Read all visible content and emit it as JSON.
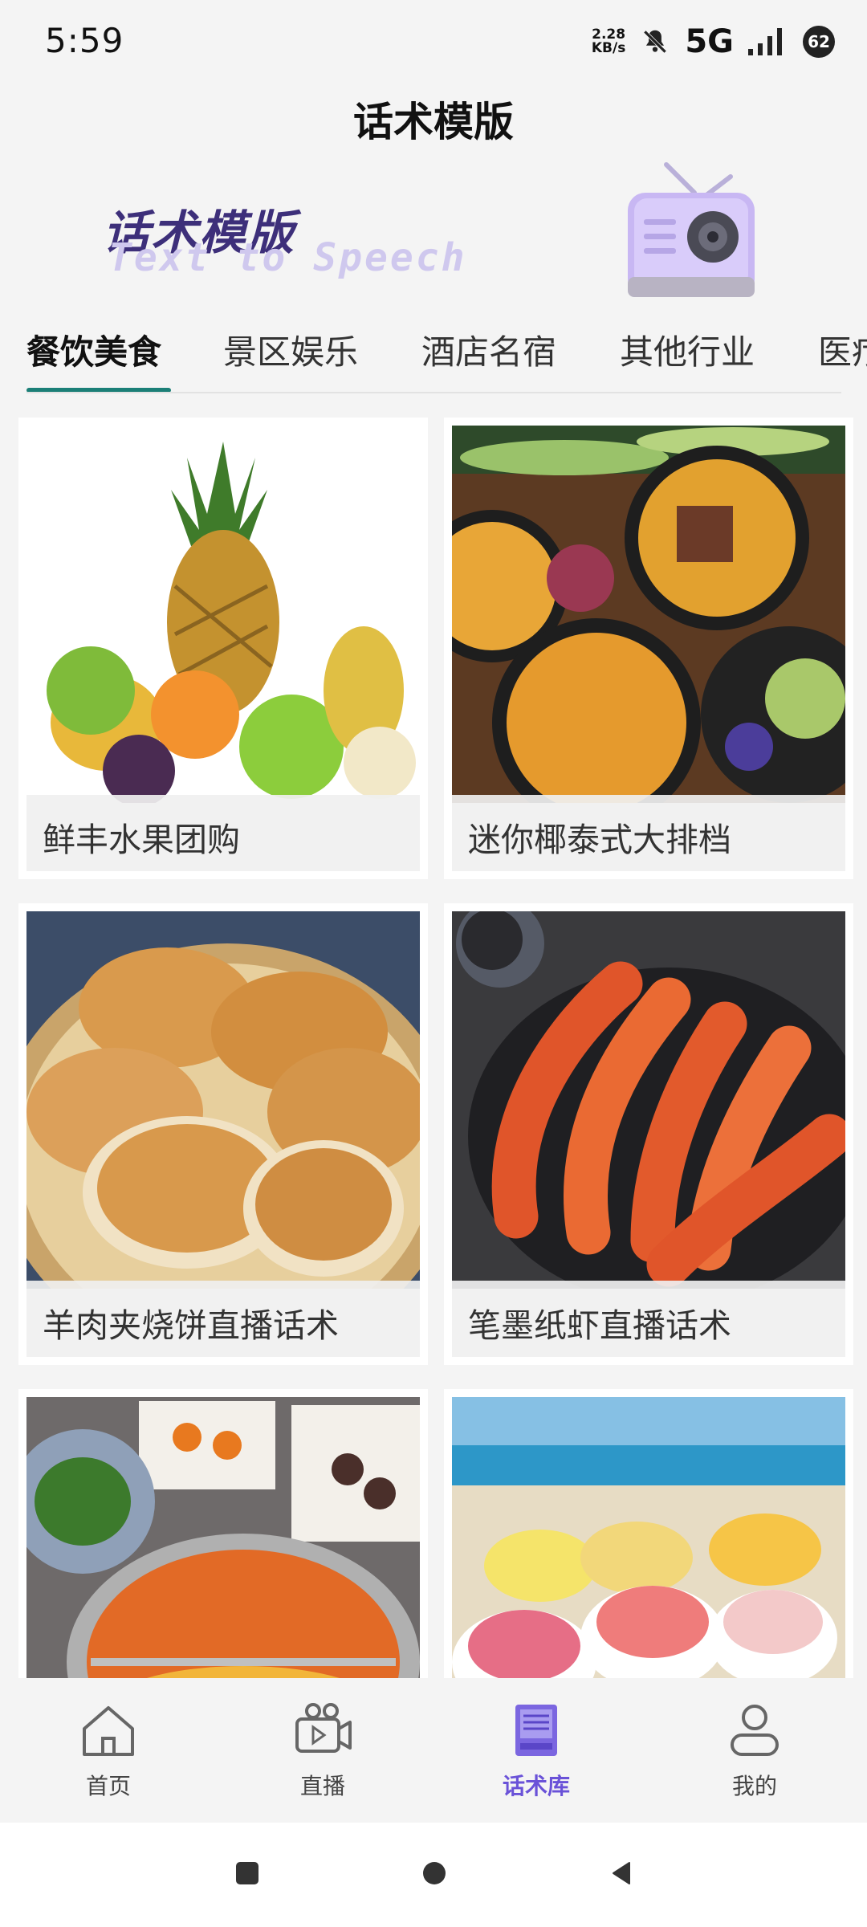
{
  "status_bar": {
    "time": "5:59",
    "net_speed_value": "2.28",
    "net_speed_unit": "KB/s",
    "network": "5G",
    "battery": "62"
  },
  "header": {
    "title": "话术模版"
  },
  "banner": {
    "title_cn": "话术模版",
    "title_en": "Text to Speech",
    "illustration": "radio-icon"
  },
  "tabs": [
    {
      "label": "餐饮美食",
      "active": true
    },
    {
      "label": "景区娱乐",
      "active": false
    },
    {
      "label": "酒店名宿",
      "active": false
    },
    {
      "label": "其他行业",
      "active": false
    },
    {
      "label": "医疗",
      "active": false
    }
  ],
  "templates": [
    {
      "title": "鲜丰水果团购",
      "image": "fruit-photo"
    },
    {
      "title": "迷你椰泰式大排档",
      "image": "thai-curry-photo"
    },
    {
      "title": "羊肉夹烧饼直播话术",
      "image": "sesame-flatbread-photo"
    },
    {
      "title": "笔墨纸虾直播话术",
      "image": "grilled-shrimp-photo"
    },
    {
      "title": "",
      "image": "hotpot-photo"
    },
    {
      "title": "",
      "image": "ice-cream-beach-photo"
    }
  ],
  "bottom_nav": [
    {
      "label": "首页",
      "icon": "home-icon",
      "active": false
    },
    {
      "label": "直播",
      "icon": "live-camera-icon",
      "active": false
    },
    {
      "label": "话术库",
      "icon": "script-library-icon",
      "active": true
    },
    {
      "label": "我的",
      "icon": "profile-icon",
      "active": false
    }
  ],
  "colors": {
    "accent": "#6a52d8",
    "tab_underline": "#1b7f77",
    "background": "#f4f4f4"
  }
}
